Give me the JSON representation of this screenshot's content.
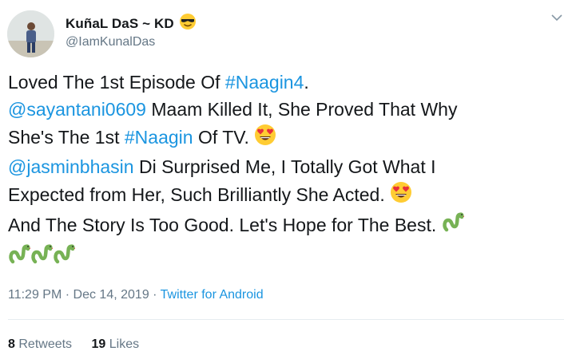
{
  "author": {
    "display_name": "KuñaL DaS ~ KD",
    "name_emoji": "smiling-face-with-sunglasses",
    "handle": "@IamKunalDas"
  },
  "tweet": {
    "line1_a": "Loved The 1st Episode Of ",
    "hashtag_naagin4": "#Naagin4",
    "line1_b": ".",
    "mention_sayantani": "@sayantani0609",
    "line2_b": " Maam Killed It, She Proved That Why",
    "line3_a": "She's The 1st ",
    "hashtag_naagin": "#Naagin",
    "line3_b": " Of TV. ",
    "mention_jasmin": "@jasminbhasin",
    "line4_b": " Di Surprised Me, I Totally Got What I",
    "line5": "Expected from Her, Such Brilliantly She Acted. ",
    "line6": "And The Story Is Too Good. Let's Hope for The Best. ",
    "emojis": [
      "heart-eyes-face",
      "heart-eyes-face",
      "snake",
      "snake",
      "snake",
      "snake"
    ]
  },
  "meta": {
    "time": "11:29 PM",
    "separator": "·",
    "date": "Dec 14, 2019",
    "source": "Twitter for Android"
  },
  "stats": {
    "retweets_count": "8",
    "retweets_label": "Retweets",
    "likes_count": "19",
    "likes_label": "Likes"
  },
  "colors": {
    "link": "#1b95e0",
    "text": "#14171a",
    "secondary": "#657786",
    "divider": "#e6ecf0"
  }
}
